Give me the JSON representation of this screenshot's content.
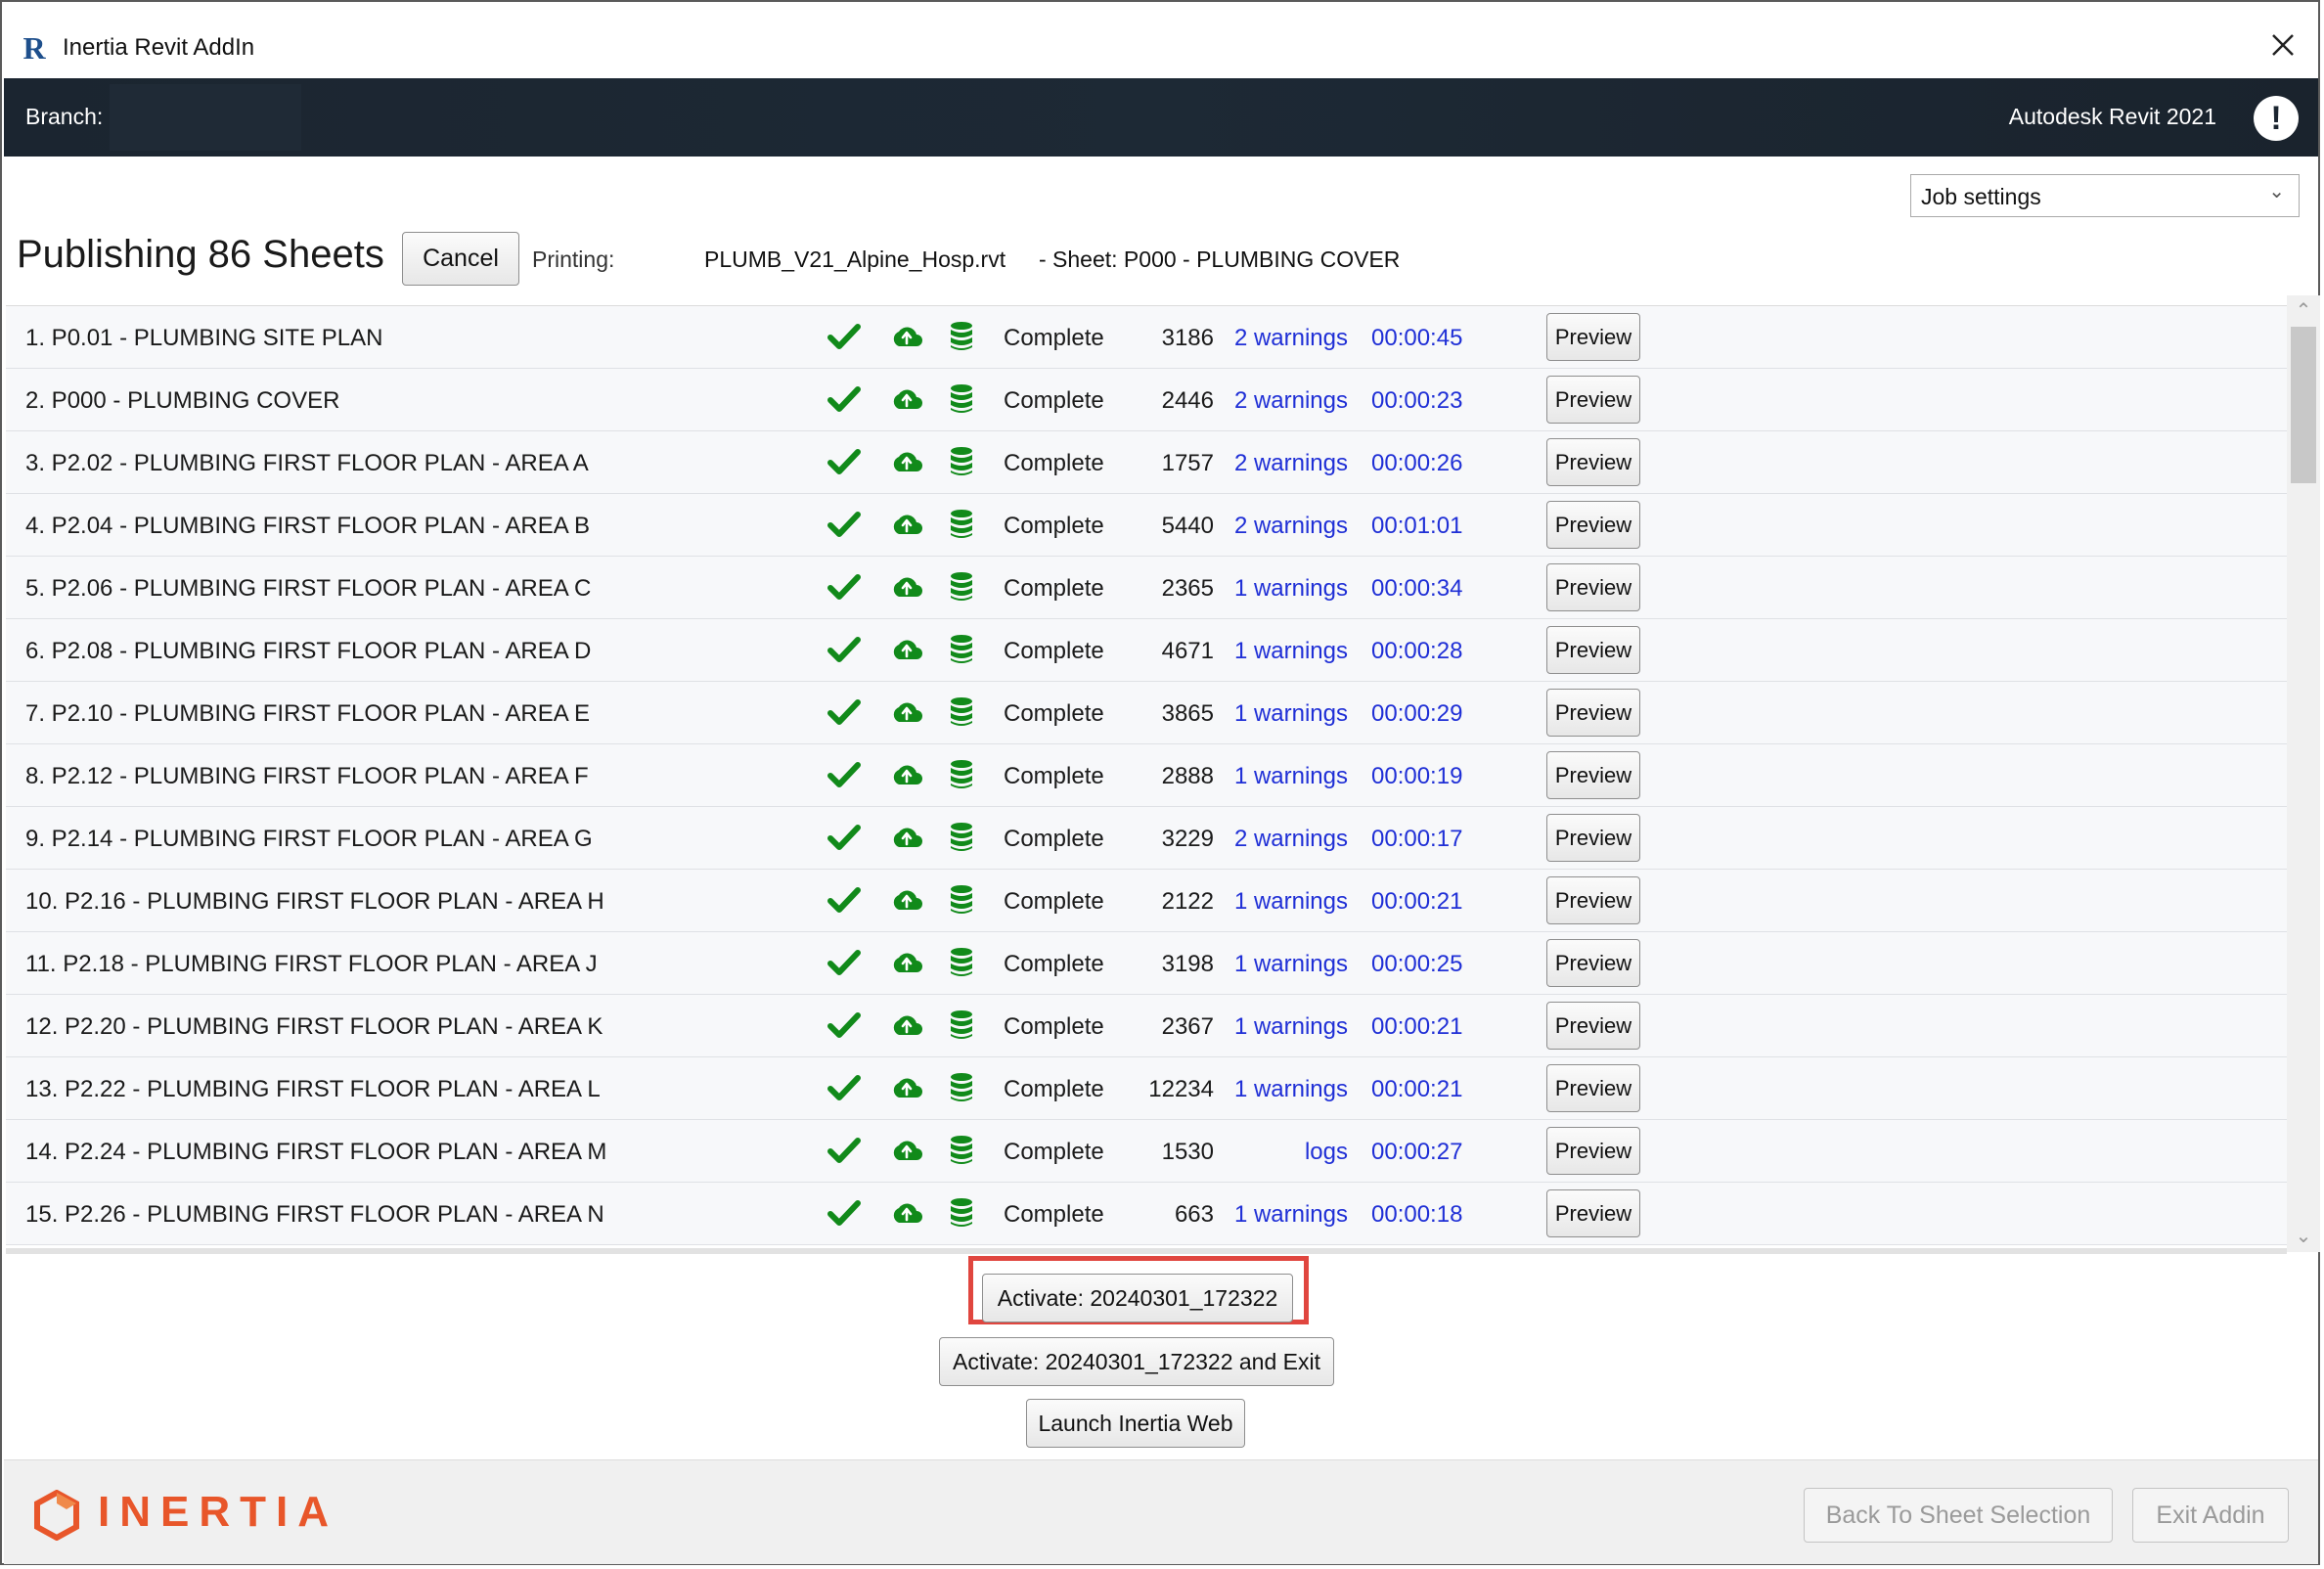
{
  "window": {
    "title": "Inertia Revit AddIn",
    "app_logo": "R"
  },
  "header": {
    "branch_label": "Branch:",
    "revit_version": "Autodesk Revit 2021"
  },
  "job_settings": {
    "selected": "Job settings"
  },
  "publish": {
    "title": "Publishing 86 Sheets",
    "cancel_label": "Cancel",
    "printing_label": "Printing:",
    "printing_file": "PLUMB_V21_Alpine_Hosp.rvt",
    "printing_sheet": "- Sheet: P000 - PLUMBING COVER"
  },
  "colors": {
    "accent_blue": "#1f2fd6",
    "success_green": "#118a1a",
    "brand_orange": "#e8562a",
    "highlight_red": "#e0463f"
  },
  "icons": {
    "check": "check-icon",
    "cloud": "cloud-upload-icon",
    "db": "database-icon"
  },
  "rows": [
    {
      "name": "1. P0.01 - PLUMBING SITE PLAN",
      "status": "Complete",
      "count": "3186",
      "warnings": "2 warnings",
      "time": "00:00:45",
      "preview": "Preview"
    },
    {
      "name": "2. P000 - PLUMBING COVER",
      "status": "Complete",
      "count": "2446",
      "warnings": "2 warnings",
      "time": "00:00:23",
      "preview": "Preview"
    },
    {
      "name": "3. P2.02 - PLUMBING FIRST FLOOR PLAN - AREA A",
      "status": "Complete",
      "count": "1757",
      "warnings": "2 warnings",
      "time": "00:00:26",
      "preview": "Preview"
    },
    {
      "name": "4. P2.04 - PLUMBING FIRST FLOOR PLAN - AREA B",
      "status": "Complete",
      "count": "5440",
      "warnings": "2 warnings",
      "time": "00:01:01",
      "preview": "Preview"
    },
    {
      "name": "5. P2.06 - PLUMBING FIRST FLOOR PLAN - AREA C",
      "status": "Complete",
      "count": "2365",
      "warnings": "1 warnings",
      "time": "00:00:34",
      "preview": "Preview"
    },
    {
      "name": "6. P2.08 - PLUMBING FIRST FLOOR PLAN - AREA D",
      "status": "Complete",
      "count": "4671",
      "warnings": "1 warnings",
      "time": "00:00:28",
      "preview": "Preview"
    },
    {
      "name": "7. P2.10 - PLUMBING FIRST FLOOR PLAN - AREA E",
      "status": "Complete",
      "count": "3865",
      "warnings": "1 warnings",
      "time": "00:00:29",
      "preview": "Preview"
    },
    {
      "name": "8. P2.12 - PLUMBING FIRST FLOOR PLAN - AREA F",
      "status": "Complete",
      "count": "2888",
      "warnings": "1 warnings",
      "time": "00:00:19",
      "preview": "Preview"
    },
    {
      "name": "9. P2.14 - PLUMBING FIRST FLOOR PLAN - AREA G",
      "status": "Complete",
      "count": "3229",
      "warnings": "2 warnings",
      "time": "00:00:17",
      "preview": "Preview"
    },
    {
      "name": "10. P2.16 - PLUMBING FIRST FLOOR PLAN - AREA H",
      "status": "Complete",
      "count": "2122",
      "warnings": "1 warnings",
      "time": "00:00:21",
      "preview": "Preview"
    },
    {
      "name": "11. P2.18 - PLUMBING FIRST FLOOR PLAN - AREA J",
      "status": "Complete",
      "count": "3198",
      "warnings": "1 warnings",
      "time": "00:00:25",
      "preview": "Preview"
    },
    {
      "name": "12. P2.20 - PLUMBING FIRST FLOOR PLAN - AREA K",
      "status": "Complete",
      "count": "2367",
      "warnings": "1 warnings",
      "time": "00:00:21",
      "preview": "Preview"
    },
    {
      "name": "13. P2.22 - PLUMBING FIRST FLOOR PLAN - AREA L",
      "status": "Complete",
      "count": "12234",
      "warnings": "1 warnings",
      "time": "00:00:21",
      "preview": "Preview"
    },
    {
      "name": "14. P2.24 - PLUMBING FIRST FLOOR PLAN - AREA M",
      "status": "Complete",
      "count": "1530",
      "warnings": "logs",
      "time": "00:00:27",
      "preview": "Preview"
    },
    {
      "name": "15. P2.26 - PLUMBING FIRST FLOOR PLAN - AREA N",
      "status": "Complete",
      "count": "663",
      "warnings": "1 warnings",
      "time": "00:00:18",
      "preview": "Preview"
    }
  ],
  "actions": {
    "activate": "Activate: 20240301_172322",
    "activate_exit": "Activate: 20240301_172322 and Exit",
    "launch_web": "Launch Inertia Web"
  },
  "footer": {
    "brand": "INERTIA",
    "back_label": "Back To Sheet Selection",
    "exit_label": "Exit Addin"
  }
}
